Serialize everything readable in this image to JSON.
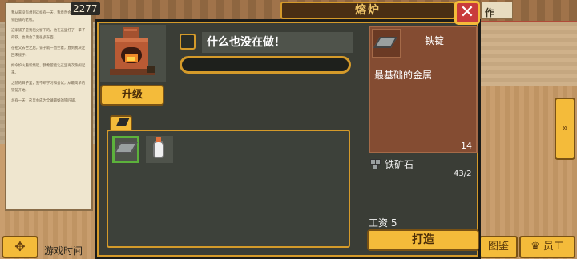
{
  "top": {
    "score": "2277",
    "make_tab": "作"
  },
  "background_note": {
    "paragraphs": [
      "我从来没有想到这样有一天，我竟然会成为一家铁匠铺的老板。",
      "这家铺子是我祖父留下的，他在这里打了一辈子的铁，也教会了我很多东西。",
      "在祖父去世之后，铺子就一直空着，直到我决定回来接手。",
      "如今炉火重新燃起，我希望能让这里再次热闹起来。",
      "之前的日子里，我不断学习和尝试，从最简单的铁锭开始。",
      "总有一天，这里会成为全镇最好的铁匠铺。"
    ]
  },
  "modal": {
    "title": "熔炉",
    "close_icon": "close-x-icon",
    "upgrade_label": "升级",
    "status_text": "什么也没在做！",
    "progress": 0
  },
  "inventory": {
    "tab_icon": "ingot-tab-icon",
    "items": [
      {
        "icon": "iron-ingot-icon",
        "selected": true
      },
      {
        "icon": "potion-bottle-icon",
        "selected": false
      }
    ]
  },
  "detail": {
    "name": "铁锭",
    "description": "最基础的金属",
    "owned_count": "14",
    "ingredient": {
      "icon": "iron-ore-icon",
      "name": "铁矿石",
      "quantity": "43/2"
    },
    "wage_label": "工资 5",
    "forge_label": "打造"
  },
  "bottom": {
    "game_time_label": "游戏时间",
    "move_icon": "move-arrows-icon",
    "gallery_label": "图鉴",
    "staff_label": "员工",
    "staff_icon": "crown-icon",
    "next_icon": "double-chevron-right-icon"
  },
  "colors": {
    "accent": "#f4bb3a",
    "frame": "#d49a2a",
    "panel": "#3a3d36",
    "card": "#844c32",
    "close": "#c93b3b"
  }
}
